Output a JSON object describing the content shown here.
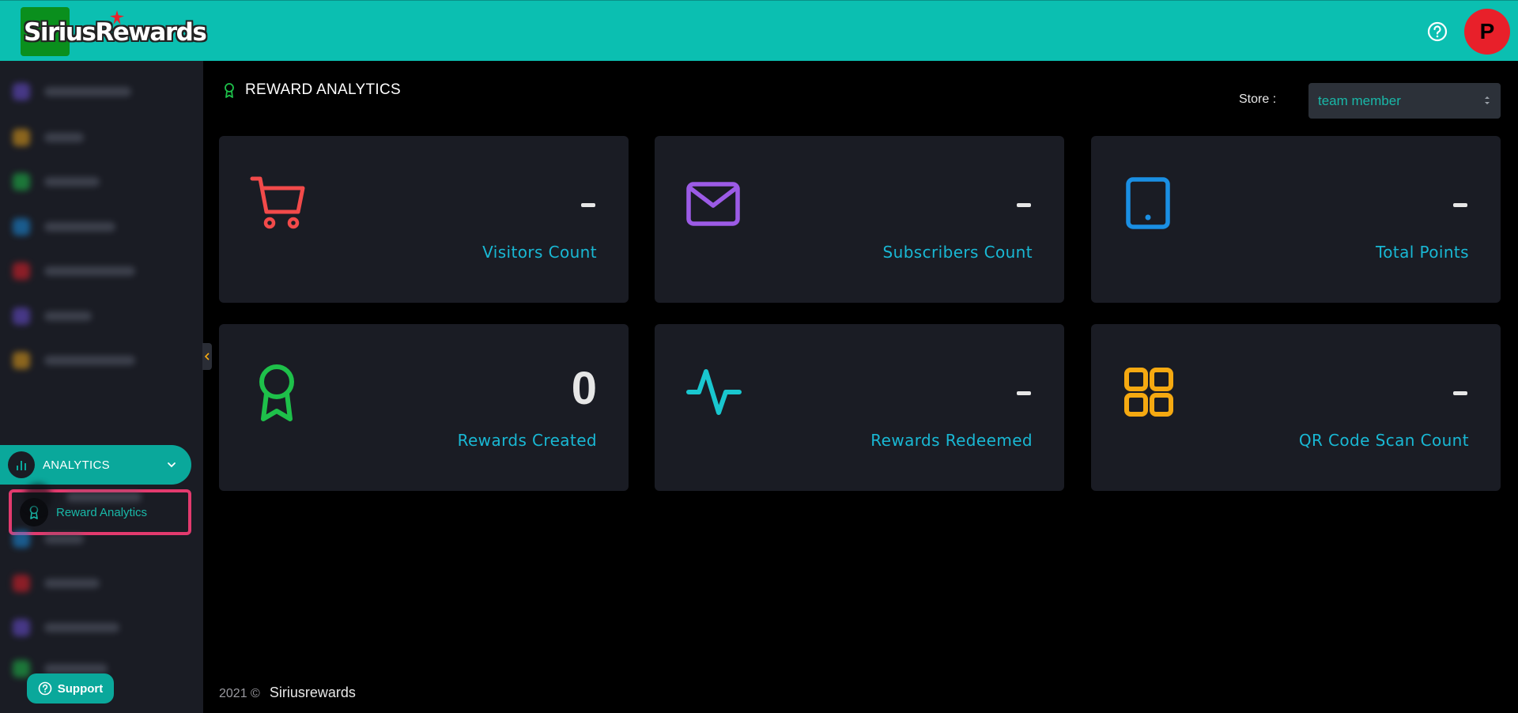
{
  "app": {
    "logo_text_1": "Sirius",
    "logo_text_2": "Rewards",
    "avatar_initial": "P"
  },
  "sidebar": {
    "analytics_label": "ANALYTICS",
    "active_item_label": "Reward Analytics",
    "support_label": "Support"
  },
  "page": {
    "title": "REWARD ANALYTICS"
  },
  "store": {
    "label": "Store :",
    "selected": "team member"
  },
  "cards": [
    {
      "label": "Visitors Count",
      "value": "-",
      "icon": "cart-icon",
      "color": "#f24a4a"
    },
    {
      "label": "Subscribers Count",
      "value": "-",
      "icon": "mail-icon",
      "color": "#9c5be6"
    },
    {
      "label": "Total Points",
      "value": "-",
      "icon": "tablet-icon",
      "color": "#1a8fe3"
    },
    {
      "label": "Rewards Created",
      "value": "0",
      "icon": "award-icon",
      "color": "#1ec04a"
    },
    {
      "label": "Rewards Redeemed",
      "value": "-",
      "icon": "activity-icon",
      "color": "#19c7cf"
    },
    {
      "label": "QR Code Scan Count",
      "value": "-",
      "icon": "grid-icon",
      "color": "#f5a911"
    }
  ],
  "footer": {
    "year": "2021 ©",
    "brand": "Siriusrewards"
  }
}
